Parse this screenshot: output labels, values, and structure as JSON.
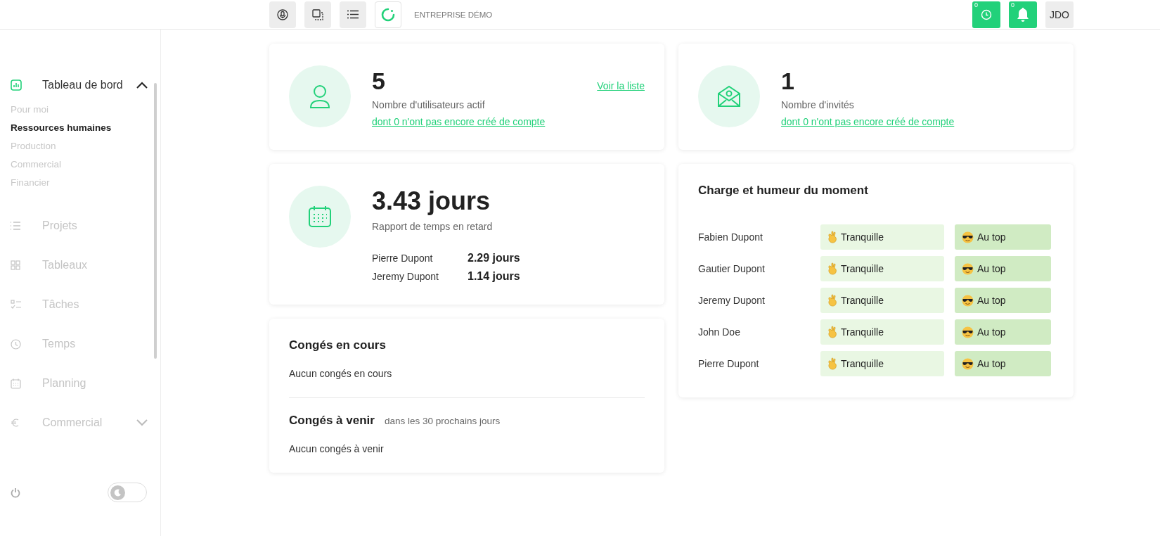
{
  "topbar": {
    "company": "ENTREPRISE DÉMO",
    "timer_badge": "0",
    "bell_badge": "0",
    "avatar": "JDO"
  },
  "sidebar": {
    "items": [
      {
        "label": "Tableau de bord",
        "selected": true,
        "expanded": true,
        "children": [
          {
            "label": "Pour moi",
            "selected": false
          },
          {
            "label": "Ressources humaines",
            "selected": true
          },
          {
            "label": "Production",
            "selected": false
          },
          {
            "label": "Commercial",
            "selected": false
          },
          {
            "label": "Financier",
            "selected": false
          }
        ]
      },
      {
        "label": "Projets",
        "selected": false
      },
      {
        "label": "Tableaux",
        "selected": false
      },
      {
        "label": "Tâches",
        "selected": false
      },
      {
        "label": "Temps",
        "selected": false
      },
      {
        "label": "Planning",
        "selected": false
      },
      {
        "label": "Commercial",
        "selected": false,
        "expanded": false
      }
    ],
    "dark_mode": {
      "on": false
    }
  },
  "users_card": {
    "value": "5",
    "label": "Nombre d'utilisateurs actif",
    "link": "dont 0 n'ont pas encore créé de compte",
    "action": "Voir la liste"
  },
  "invites_card": {
    "value": "1",
    "label": "Nombre d'invités",
    "link": "dont 0 n'ont pas encore créé de compte"
  },
  "late_card": {
    "value": "3.43 jours",
    "label": "Rapport de temps en retard",
    "rows": [
      {
        "name": "Pierre Dupont",
        "value": "2.29 jours"
      },
      {
        "name": "Jeremy Dupont",
        "value": "1.14 jours"
      }
    ]
  },
  "mood_card": {
    "title": "Charge et humeur du moment",
    "rows": [
      {
        "name": "Fabien Dupont",
        "charge": "Tranquille",
        "mood": "Au top"
      },
      {
        "name": "Gautier Dupont",
        "charge": "Tranquille",
        "mood": "Au top"
      },
      {
        "name": "Jeremy Dupont",
        "charge": "Tranquille",
        "mood": "Au top"
      },
      {
        "name": "John Doe",
        "charge": "Tranquille",
        "mood": "Au top"
      },
      {
        "name": "Pierre Dupont",
        "charge": "Tranquille",
        "mood": "Au top"
      }
    ]
  },
  "leave_card": {
    "current_title": "Congés en cours",
    "current_empty": "Aucun congés en cours",
    "upcoming_title": "Congés à venir",
    "upcoming_subtitle": "dans les 30 prochains jours",
    "upcoming_empty": "Aucun congés à venir"
  }
}
